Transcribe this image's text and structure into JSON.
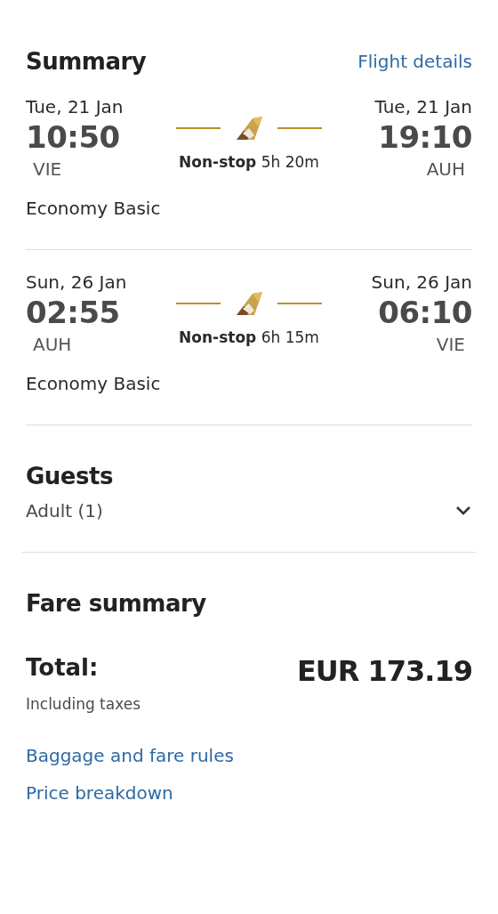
{
  "summary": {
    "title": "Summary",
    "link": "Flight details"
  },
  "flights": [
    {
      "depart_date": "Tue, 21 Jan",
      "depart_time": "10:50",
      "depart_airport": "VIE",
      "stops": "Non-stop",
      "duration": "5h 20m",
      "arrive_date": "Tue, 21 Jan",
      "arrive_time": "19:10",
      "arrive_airport": "AUH",
      "cabin": "Economy Basic"
    },
    {
      "depart_date": "Sun, 26 Jan",
      "depart_time": "02:55",
      "depart_airport": "AUH",
      "stops": "Non-stop",
      "duration": "6h 15m",
      "arrive_date": "Sun, 26 Jan",
      "arrive_time": "06:10",
      "arrive_airport": "VIE",
      "cabin": "Economy Basic"
    }
  ],
  "guests": {
    "title": "Guests",
    "value": "Adult (1)",
    "expanded": false
  },
  "fare_summary": {
    "title": "Fare summary",
    "total_label": "Total:",
    "total_value": "EUR 173.19",
    "note": "Including taxes"
  },
  "links": [
    "Baggage and fare rules",
    "Price breakdown"
  ]
}
